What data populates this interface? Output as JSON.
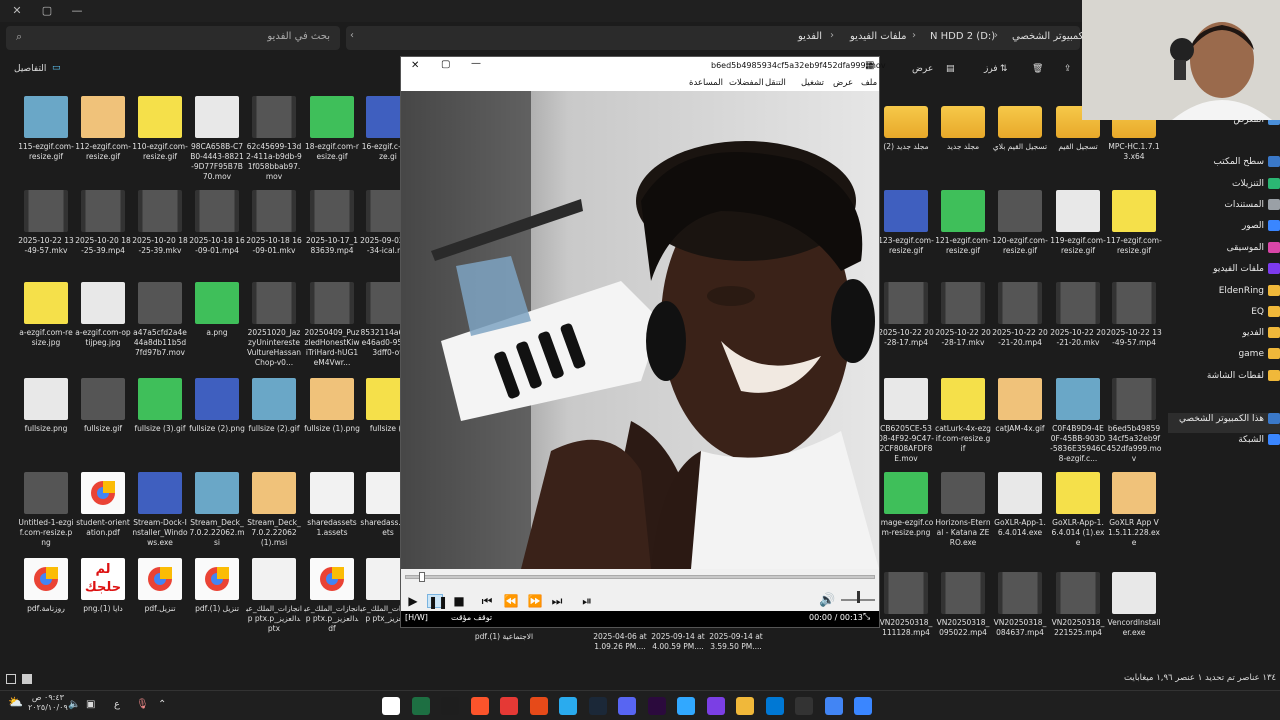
{
  "explorer": {
    "search_placeholder": "بحث في الفديو",
    "breadcrumb": [
      "الكمبيوتر الشخصي",
      "N HDD 2 (D:)",
      "ملفات الفيديو",
      "الفديو"
    ],
    "details_label": "التفاصيل",
    "cmd": {
      "view": "عرض",
      "sort": "فرز"
    },
    "left_files_row1": [
      "115-ezgif.com-resize.gif",
      "112-ezgif.com-resize.gif",
      "110-ezgif.com-resize.gif",
      "98CA658B-C7B0-4443-8821-9D77F95B7B70.mov",
      "62c45699-13d2-411a-b9db-91f058bbab97.mov",
      "18-ezgif.com-resize.gif",
      "16-ezgif.c-resize.gi"
    ],
    "left_files_row2": [
      "2025-10-22 13-49-57.mkv",
      "2025-10-20 18-25-39.mp4",
      "2025-10-20 18-25-39.mkv",
      "2025-10-18 16-09-01.mp4",
      "2025-10-18 16-09-01.mkv",
      "2025-10-17_183639.mp4",
      "2025-09-02-18-34-ical.mp"
    ],
    "left_files_row3": [
      "a-ezgif.com-resize.jpg",
      "a-ezgif.com-optijpeg.jpg",
      "a47a5cfd2a4e44a8db11b5d7fd97b7.mov",
      "a.png",
      "20251020_JazzyUninteresteVultureHassanChop-v0...",
      "20250409_PuzzledHonestKiwiTriHard-hUG1eM4Vwr...",
      "8532114a6-64e46ad0-959fd3dff0-ov"
    ],
    "left_files_row4": [
      "fullsize.png",
      "fullsize.gif",
      "fullsize (3).gif",
      "fullsize (2).png",
      "fullsize (2).gif",
      "fullsize (1).png",
      "fullsize (1"
    ],
    "left_files_row5": [
      "Untitled-1-ezgif.com-resize.png",
      "student-orientation.pdf",
      "Stream-Dock-Installer_Windows.exe",
      "Stream_Deck_7.0.2.22062.msi",
      "Stream_Deck_7.0.2.22062 (1).msi",
      "sharedassets1.assets",
      "sharedass..assets"
    ],
    "left_files_row6": [
      "روزنامة.pdf",
      "دايا (1).png",
      "تنزيل.pdf",
      "تنزيل (1).pdf",
      "انجازات_الملك_عبدالعزيز_p ptx.pptx",
      "انجازات_الملك_عبدالعزيز_p ptx.pdf",
      "انجازات_الملك_عبدالعزيز_p ptx"
    ],
    "lam_text": "لم حلجك",
    "under_mpc": [
      "الاجتماعية (1).pdf",
      "2025-04-06 at 1.09.26 PM....",
      "2025-09-14 at 4.00.59 PM....",
      "2025-09-14 at 3.59.50 PM...."
    ],
    "right_files_row1": [
      "MPC-HC.1.7.13.x64",
      "تسجيل القيم",
      "تسجيل القيم بلاي",
      "مجلد جديد",
      "مجلد جديد (2)"
    ],
    "right_files_row2": [
      "117-ezgif.com-resize.gif",
      "119-ezgif.com-resize.gif",
      "120-ezgif.com-resize.gif",
      "121-ezgif.com-resize.gif",
      "123-ezgif.com-resize.gif"
    ],
    "right_files_row3": [
      "2025-10-22 13-49-57.mp4",
      "2025-10-22 20-21-20.mkv",
      "2025-10-22 20-21-20.mp4",
      "2025-10-22 20-28-17.mkv",
      "2025-10-22 20-28-17.mp4"
    ],
    "right_files_row4": [
      "b6ed5b4985934cf5a32eb9f452dfa999.mov",
      "C0F4B9D9-4E0F-45BB-903D-5836E35946C8-ezgif.c...",
      "catJAM-4x.gif",
      "catLurk-4x-ezgif.com-resize.gif",
      "CB6205CE-5308-4F92-9C47-2CF808AFDF8E.mov"
    ],
    "right_files_row5": [
      "GoXLR App V1.5.11.228.exe",
      "GoXLR-App-1.6.4.014 (1).exe",
      "GoXLR-App-1.6.4.014.exe",
      "Horizons-Eternal - Katana ZERO.exe",
      "image-ezgif.com-resize.png"
    ],
    "right_files_row6": [
      "VencordInstaller.exe",
      "VN20250318_221525.mp4",
      "VN20250318_084637.mp4",
      "VN20250318_095022.mp4",
      "VN20250318_111128.mp4"
    ],
    "sidebar": [
      "المعرض",
      "سطح المكتب",
      "التنزيلات",
      "المستندات",
      "الصور",
      "الموسيقى",
      "ملفات الفيديو",
      "EldenRing",
      "EQ",
      "الفديو",
      "game",
      "لقطات الشاشة",
      "هذا الكمبيوتر الشخصي",
      "الشبكة"
    ],
    "status": "١٣٤ عناصر   تم تحديد ١ عنصر ١,٩٦ ميغابايت"
  },
  "mpc": {
    "title": "b6ed5b4985934cf5a32eb9f452dfa999.mov",
    "menu": [
      "ملف",
      "عرض",
      "تشغيل",
      "التنقل",
      "المفضلات",
      "المساعدة"
    ],
    "status_left": "[H/W]",
    "status_text": "توقف مؤقت",
    "time": "00:00 / 00:13",
    "progress": 0.03
  },
  "taskbar": {
    "time": "٠٩:٤٣ ص",
    "date": "٢٠٢٥/١٠/٠٩",
    "lang": "ع"
  },
  "colors": {
    "folder": "#f0b83a",
    "accent": "#60cdff",
    "player_bg": "#f0f0f0"
  }
}
